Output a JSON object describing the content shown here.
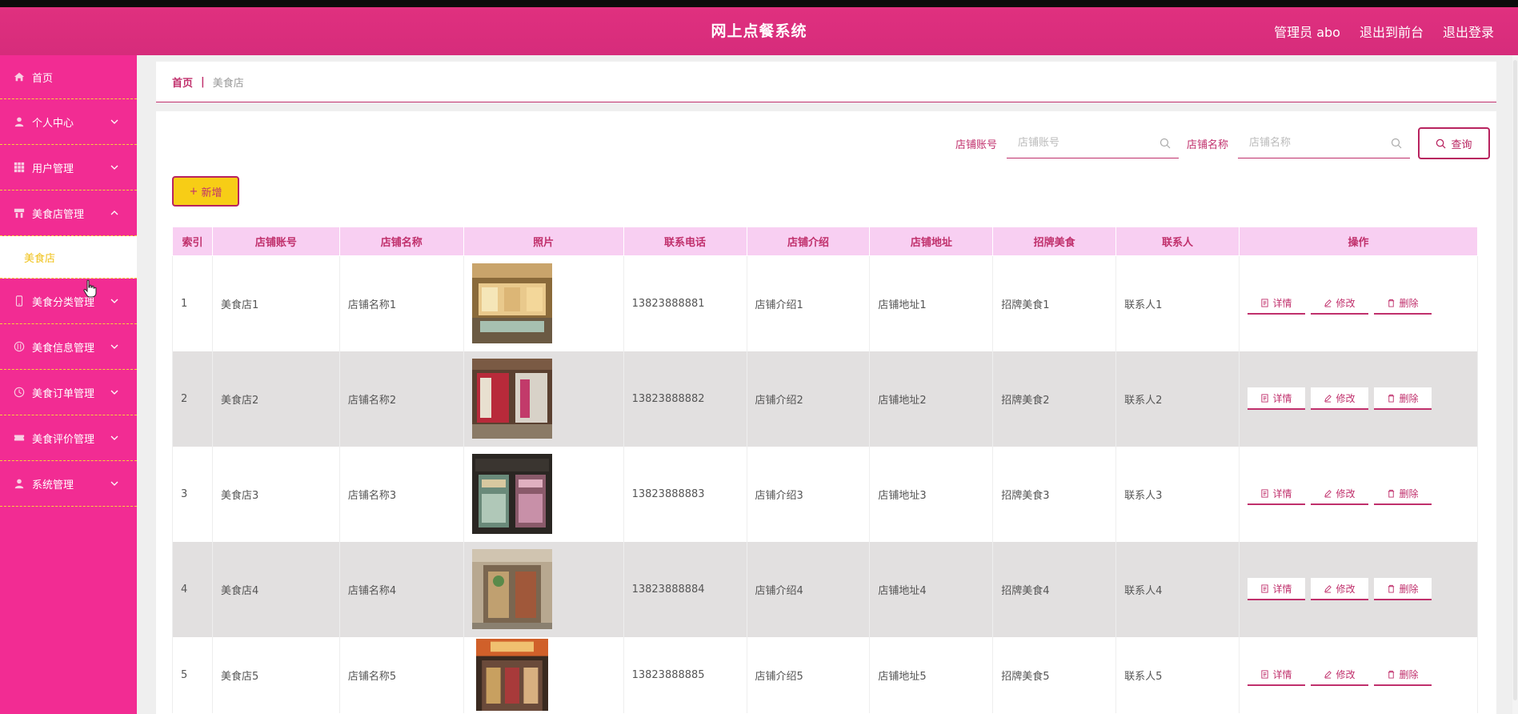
{
  "header": {
    "title": "网上点餐系统",
    "user": "管理员 abo",
    "to_front": "退出到前台",
    "logout": "退出登录"
  },
  "sidebar": {
    "items": [
      {
        "label": "首页",
        "icon": "home-icon"
      },
      {
        "label": "个人中心",
        "icon": "user-icon"
      },
      {
        "label": "用户管理",
        "icon": "grid-icon"
      },
      {
        "label": "美食店管理",
        "icon": "shop-icon",
        "expanded": true
      },
      {
        "label": "美食分类管理",
        "icon": "phone-icon"
      },
      {
        "label": "美食信息管理",
        "icon": "food-icon"
      },
      {
        "label": "美食订单管理",
        "icon": "clock-icon"
      },
      {
        "label": "美食评价管理",
        "icon": "ticket-icon"
      },
      {
        "label": "系统管理",
        "icon": "user-icon"
      }
    ],
    "submenu": "美食店"
  },
  "breadcrumb": {
    "home": "首页",
    "sep": "|",
    "current": "美食店"
  },
  "search": {
    "account_label": "店铺账号",
    "account_placeholder": "店铺账号",
    "name_label": "店铺名称",
    "name_placeholder": "店铺名称",
    "query_label": "查询"
  },
  "add_label": "新增",
  "table": {
    "headers": [
      "索引",
      "店铺账号",
      "店铺名称",
      "照片",
      "联系电话",
      "店铺介绍",
      "店铺地址",
      "招牌美食",
      "联系人",
      "操作"
    ],
    "rows": [
      {
        "idx": "1",
        "account": "美食店1",
        "name": "店铺名称1",
        "phone": "13823888881",
        "intro": "店铺介绍1",
        "addr": "店铺地址1",
        "food": "招牌美食1",
        "contact": "联系人1"
      },
      {
        "idx": "2",
        "account": "美食店2",
        "name": "店铺名称2",
        "phone": "13823888882",
        "intro": "店铺介绍2",
        "addr": "店铺地址2",
        "food": "招牌美食2",
        "contact": "联系人2"
      },
      {
        "idx": "3",
        "account": "美食店3",
        "name": "店铺名称3",
        "phone": "13823888883",
        "intro": "店铺介绍3",
        "addr": "店铺地址3",
        "food": "招牌美食3",
        "contact": "联系人3"
      },
      {
        "idx": "4",
        "account": "美食店4",
        "name": "店铺名称4",
        "phone": "13823888884",
        "intro": "店铺介绍4",
        "addr": "店铺地址4",
        "food": "招牌美食4",
        "contact": "联系人4"
      },
      {
        "idx": "5",
        "account": "美食店5",
        "name": "店铺名称5",
        "phone": "13823888885",
        "intro": "店铺介绍5",
        "addr": "店铺地址5",
        "food": "招牌美食5",
        "contact": "联系人5"
      }
    ],
    "ops": {
      "detail": "详情",
      "edit": "修改",
      "delete": "删除"
    }
  },
  "colors": {
    "header": "#d62c7b",
    "sidebar": "#f22c93",
    "accent": "#c0306c",
    "add_button": "#f7cd16",
    "table_head": "#f8cff2"
  }
}
